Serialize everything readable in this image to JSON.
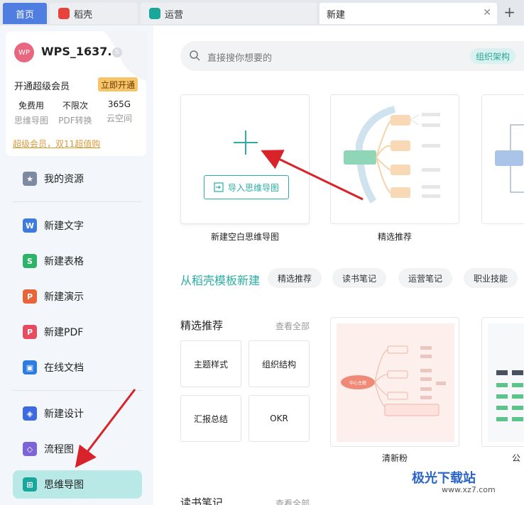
{
  "tabs": {
    "home": "首页",
    "daoke": "稻壳",
    "yunying": "运营",
    "new": "新建",
    "close": "✕",
    "add": "+"
  },
  "user": {
    "avatar": "WP",
    "name": "WPS_1637...",
    "vip_badge": "S",
    "vip_text": "开通超级会员",
    "vip_btn": "立即开通",
    "benefits": [
      {
        "top": "免费用",
        "bottom": "思维导图"
      },
      {
        "top": "不限次",
        "bottom": "PDF转换"
      },
      {
        "top": "365G",
        "bottom": "云空间"
      }
    ],
    "promo": "超级会员，双11超值购"
  },
  "nav": [
    {
      "label": "我的资源",
      "icon": "star-icon",
      "color": "#7d8aa0"
    },
    {
      "label": "新建文字",
      "icon": "W",
      "color": "#3d7bdc"
    },
    {
      "label": "新建表格",
      "icon": "S",
      "color": "#2fb36a"
    },
    {
      "label": "新建演示",
      "icon": "P",
      "color": "#e8653a"
    },
    {
      "label": "新建PDF",
      "icon": "P",
      "color": "#e84a5f"
    },
    {
      "label": "在线文档",
      "icon": "doc-icon",
      "color": "#2d7ce0"
    },
    {
      "label": "新建设计",
      "icon": "design-icon",
      "color": "#3d6ae0"
    },
    {
      "label": "流程图",
      "icon": "flow-icon",
      "color": "#7b63d8"
    },
    {
      "label": "思维导图",
      "icon": "mindmap-icon",
      "color": "#19a79b"
    }
  ],
  "search": {
    "placeholder": "直接搜你想要的",
    "chip": "组织架构"
  },
  "new_card": {
    "import": "导入思维导图",
    "label": "新建空白思维导图"
  },
  "recommend_label": "精选推荐",
  "template_section": {
    "title": "从稻壳模板新建",
    "pills": [
      "精选推荐",
      "读书笔记",
      "运营笔记",
      "职业技能"
    ]
  },
  "featured": {
    "title": "精选推荐",
    "see_all": "查看全部",
    "categories": [
      "主题样式",
      "组织结构",
      "汇报总结",
      "OKR"
    ],
    "thumb_label": "清新粉",
    "thumb_label2": "公",
    "center_topic": "中心主题"
  },
  "reading": {
    "title": "读书笔记",
    "see_all": "查看全部"
  },
  "watermark": {
    "main": "极光下载站",
    "sub": "www.xz7.com"
  }
}
